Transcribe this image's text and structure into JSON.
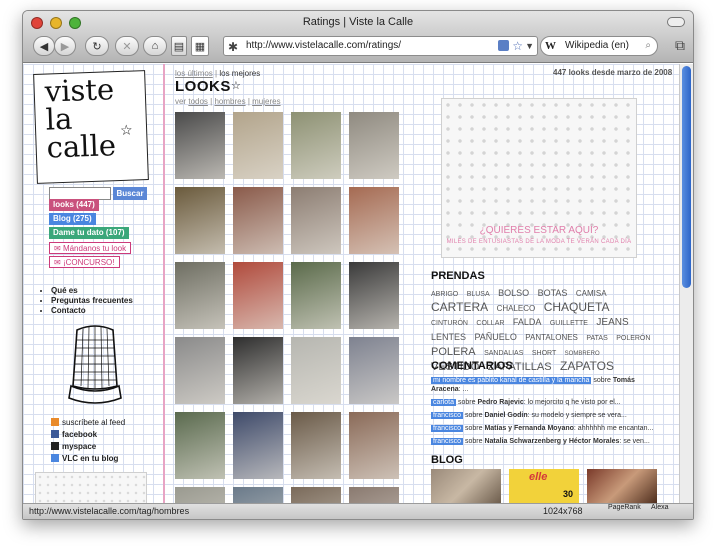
{
  "window": {
    "title": "Ratings | Viste la Calle"
  },
  "toolbar": {
    "url": "http://www.vistelacalle.com/ratings/",
    "search_engine": "Wikipedia (en)"
  },
  "status": {
    "url": "http://www.vistelacalle.com/tag/hombres",
    "resolution": "1024x768",
    "pagerank_label": "PageRank",
    "alexa_label": "Alexa"
  },
  "sidebar": {
    "logo_line1": "viste",
    "logo_line2": "la",
    "logo_line3": "calle",
    "search_button": "Buscar",
    "buttons": [
      {
        "label": "looks (447)",
        "color": "#c9517d"
      },
      {
        "label": "Blog (275)",
        "color": "#4a86e0"
      },
      {
        "label": "Dame tu dato (107)",
        "color": "#3aa77a"
      },
      {
        "label": "Mándanos tu look",
        "color": "#cc3a7a"
      },
      {
        "label": "¡CONCURSO!",
        "color": "#cc3a7a"
      }
    ],
    "links": [
      "Qué es",
      "Preguntas frecuentes",
      "Contacto"
    ],
    "social": [
      "suscríbete al feed",
      "facebook",
      "myspace",
      "VLC en tu blog"
    ]
  },
  "main": {
    "crumb_recent": "los últimos",
    "crumb_sep": "|",
    "crumb_best": "los mejores",
    "title": "LOOKS",
    "filter_see": "ver",
    "filters": [
      "todos",
      "hombres",
      "mujeres"
    ],
    "count_text": "447 looks desde marzo de 2008",
    "tiles": [
      "#4a4a4a",
      "#b2a48b",
      "#8d9173",
      "#8f8a80",
      "#6a5a3c",
      "#8a5a4a",
      "#8c7d72",
      "#a56a52",
      "#6e6e62",
      "#b04a3c",
      "#5a6a4a",
      "#3a3a3a",
      "#8a8a8a",
      "#2e2e2e",
      "#b6b6b0",
      "#7e8290",
      "#5a6a4e",
      "#3e4a6a",
      "#6a5a48",
      "#8a6a58",
      "#9a9a90",
      "#6a7a8a",
      "#7a6a5a",
      "#8a7a70"
    ]
  },
  "right": {
    "ad_title": "¿QUIERES ESTAR AQUÍ?",
    "ad_sub": "MILES DE ENTUSIASTAS DE LA MODA TE VERÁN CADA DÍA",
    "prendas_title": "PRENDAS",
    "tags": [
      {
        "t": "ABRIGO",
        "s": 7
      },
      {
        "t": "BLUSA",
        "s": 7
      },
      {
        "t": "BOLSO",
        "s": 9
      },
      {
        "t": "BOTAS",
        "s": 9
      },
      {
        "t": "CAMISA",
        "s": 8
      },
      {
        "t": "CARTERA",
        "s": 12
      },
      {
        "t": "CHALECO",
        "s": 8
      },
      {
        "t": "CHAQUETA",
        "s": 12
      },
      {
        "t": "CINTURÓN",
        "s": 7
      },
      {
        "t": "COLLAR",
        "s": 7
      },
      {
        "t": "FALDA",
        "s": 9
      },
      {
        "t": "GUILLETTE",
        "s": 7
      },
      {
        "t": "JEANS",
        "s": 10
      },
      {
        "t": "LENTES",
        "s": 9
      },
      {
        "t": "PAÑUELO",
        "s": 9
      },
      {
        "t": "PANTALONES",
        "s": 8
      },
      {
        "t": "PATAS",
        "s": 7
      },
      {
        "t": "POLERÓN",
        "s": 7
      },
      {
        "t": "POLERA",
        "s": 11
      },
      {
        "t": "SANDALIAS",
        "s": 7
      },
      {
        "t": "SHORT",
        "s": 7
      },
      {
        "t": "SOMBRERO",
        "s": 6
      },
      {
        "t": "VESTIDO",
        "s": 11
      },
      {
        "t": "ZAPATILLAS",
        "s": 11
      },
      {
        "t": "ZAPATOS",
        "s": 12
      }
    ],
    "comentarios_title": "COMENTARIOS",
    "comments": [
      {
        "user": "mi nombre es pablito kanal de castilla y la mancha",
        "mid": "sobre",
        "post": "Tomás Aracena",
        "text": ": ..."
      },
      {
        "user": "carlota",
        "mid": "sobre",
        "post": "Pedro Rajevic",
        "text": ": lo mejorcito q he visto por el..."
      },
      {
        "user": "francisco",
        "mid": "sobre",
        "post": "Daniel Godin",
        "text": ": su modelo y siempre se vera..."
      },
      {
        "user": "francisco",
        "mid": "sobre",
        "post": "Matías y Fernanda Moyano",
        "text": ": ahhhhhh me encantan..."
      },
      {
        "user": "francisco",
        "mid": "sobre",
        "post": "Natalia Schwarzenberg y Héctor Morales",
        "text": ": se ven..."
      }
    ],
    "blog_title": "BLOG",
    "blog_elle": "elle",
    "blog_num": "30"
  }
}
